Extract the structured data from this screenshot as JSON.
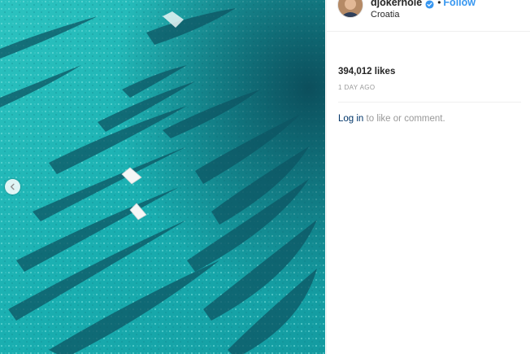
{
  "post": {
    "username": "djokernole",
    "separator": "•",
    "follow_label": "Follow",
    "location": "Croatia",
    "likes": "394,012 likes",
    "timestamp": "1 DAY AGO",
    "login_link": "Log in",
    "login_rest": " to like or comment."
  },
  "icons": {
    "verified": "verified-badge-icon",
    "carousel_prev": "chevron-left-icon"
  },
  "colors": {
    "follow": "#3897f0",
    "login_link": "#003569",
    "muted": "#999999",
    "text": "#262626",
    "water": "#1bb2b0"
  }
}
